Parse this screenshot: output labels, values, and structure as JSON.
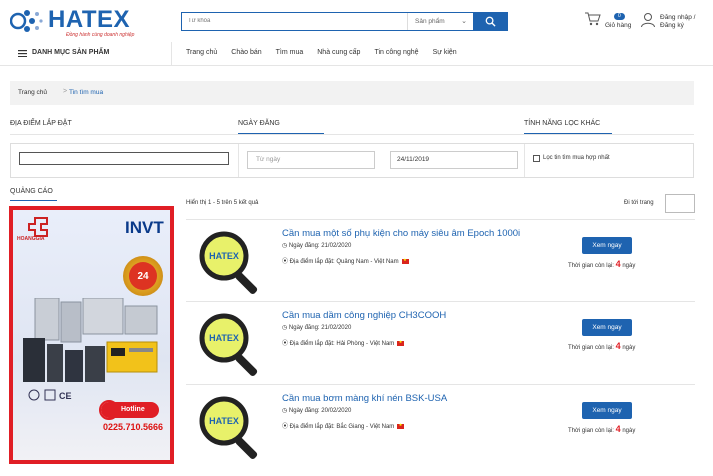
{
  "header": {
    "logo_text": "HATEX",
    "logo_slogan": "Đồng hành cùng doanh nghiệp",
    "search_placeholder": "Từ khóa",
    "search_category": "Sản phẩm",
    "cart_count": "0",
    "cart_label": "Giỏ hàng",
    "user_label": "Đăng nhập / Đăng ký"
  },
  "nav": {
    "category_menu": "DANH MỤC SẢN PHẨM",
    "links": [
      "Trang chủ",
      "Chào bán",
      "Tìm mua",
      "Nhà cung cấp",
      "Tin công nghệ",
      "Sự kiện"
    ]
  },
  "breadcrumb": {
    "home": "Trang chủ",
    "separator": ">",
    "current": "Tin tìm mua"
  },
  "filter": {
    "tab_location": "ĐỊA ĐIỂM LẮP ĐẶT",
    "tab_date": "NGÀY ĐĂNG",
    "tab_other": "TÍNH NĂNG LỌC KHÁC",
    "from_placeholder": "Từ ngày",
    "to_value": "24/11/2019",
    "checkbox_label": "Lọc tin tìm mua hợp nhất"
  },
  "ads": {
    "title": "QUẢNG CÁO",
    "brand_left": "HOANGGIA",
    "brand_right": "INVT",
    "badge": "24",
    "hotline_label": "Hotline",
    "hotline_number": "0225.710.5666"
  },
  "results": {
    "summary": "Hiển thị 1 - 5 trên 5 kết quả",
    "goto_label": "Đi tới trang",
    "view_label": "Xem ngay",
    "remain_prefix": "Thời gian còn lại:",
    "remain_suffix": "ngày",
    "items": [
      {
        "title": "Cần mua một số phụ kiện cho máy siêu âm Epoch 1000i",
        "date": "Ngày đăng: 21/02/2020",
        "location": "Địa điểm lắp đặt: Quảng Nam - Việt Nam",
        "remain_days": "4"
      },
      {
        "title": "Cần mua dầm công nghiệp CH3COOH",
        "date": "Ngày đăng: 21/02/2020",
        "location": "Địa điểm lắp đặt: Hải Phòng - Việt Nam",
        "remain_days": "4"
      },
      {
        "title": "Cần mua bơm màng khí nén BSK-USA",
        "date": "Ngày đăng: 20/02/2020",
        "location": "Địa điểm lắp đặt: Bắc Giang - Việt Nam",
        "remain_days": "4"
      }
    ],
    "thumb_label": "HATEX"
  },
  "colors": {
    "brand_blue": "#1e63b0",
    "accent_red": "#e01e25"
  }
}
